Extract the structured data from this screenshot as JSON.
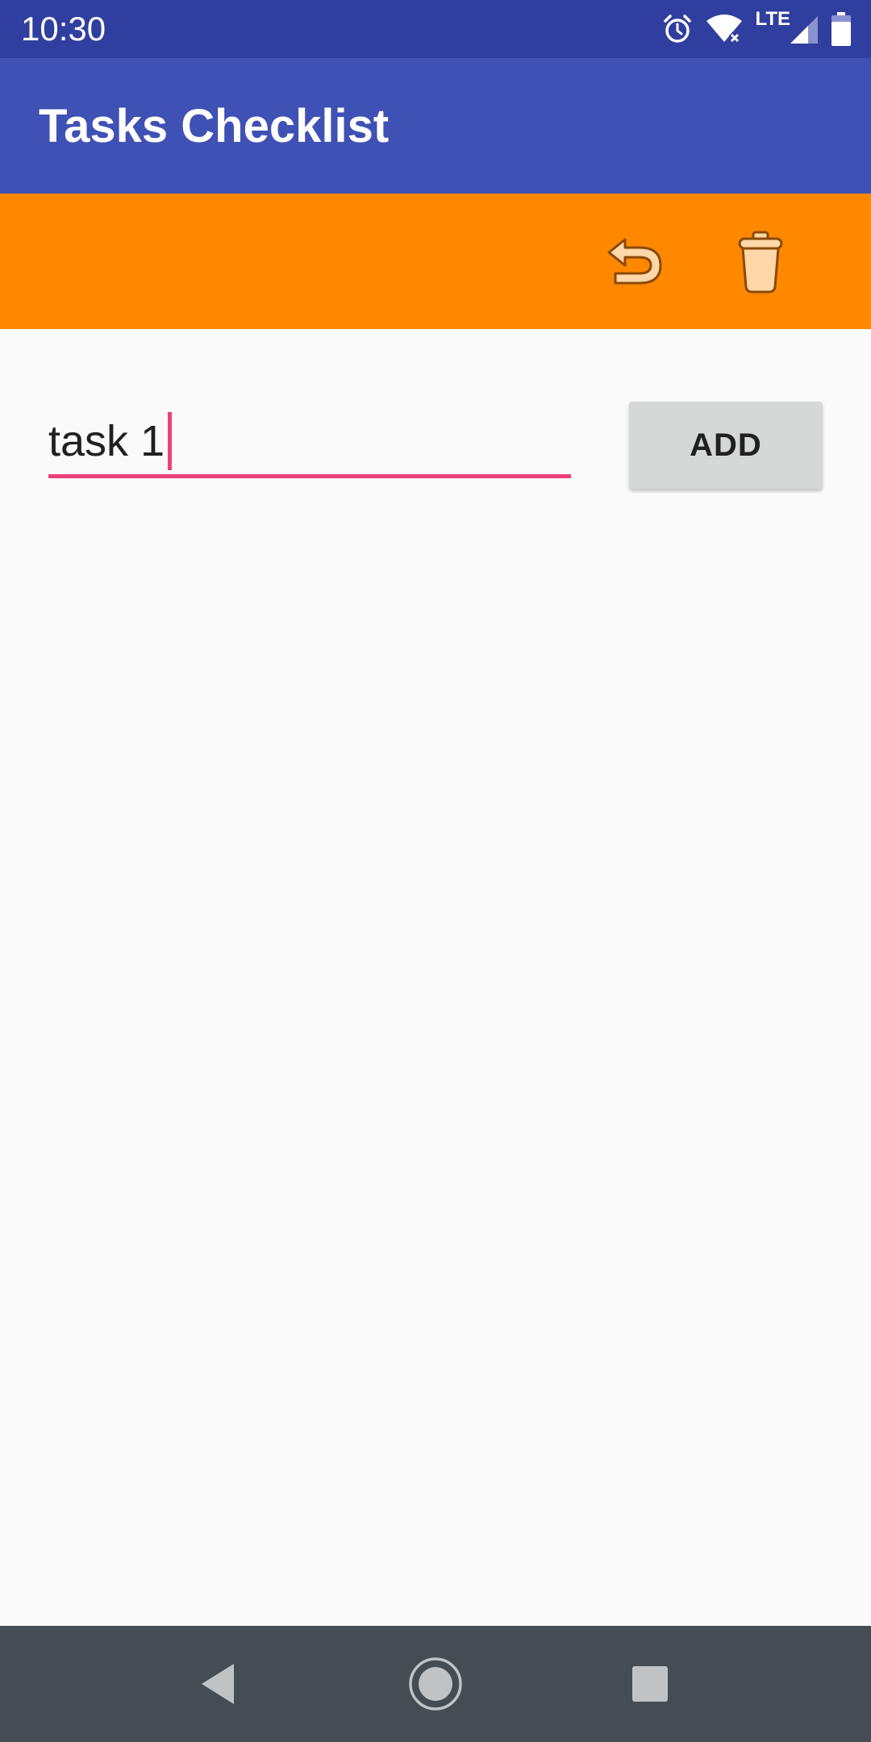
{
  "status_bar": {
    "time": "10:30",
    "network": "LTE",
    "icons": [
      "alarm-icon",
      "wifi-icon",
      "cell-signal-icon",
      "battery-icon"
    ]
  },
  "app_bar": {
    "title": "Tasks Checklist"
  },
  "toolbar": {
    "actions": [
      "undo-icon",
      "trash-icon"
    ]
  },
  "task_input": {
    "value": "task 1"
  },
  "add_button": {
    "label": "ADD"
  },
  "nav_bar": {
    "buttons": [
      "back-icon",
      "home-icon",
      "recents-icon"
    ]
  },
  "colors": {
    "status_bar": "#303f9f",
    "app_bar": "#3f51b5",
    "action_bar": "#ff8800",
    "accent": "#ec407a",
    "background": "#fafafa",
    "nav_bar": "#454c52"
  }
}
